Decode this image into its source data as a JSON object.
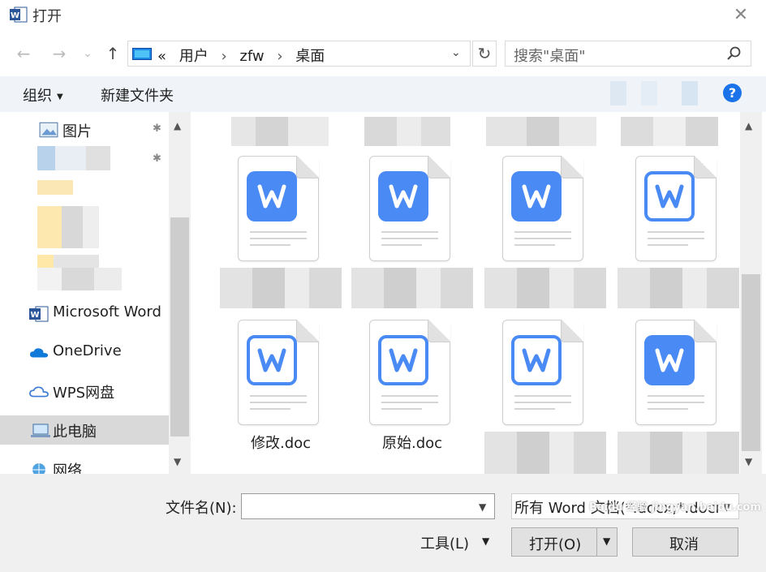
{
  "window": {
    "title": "打开",
    "close_glyph": "✕"
  },
  "nav": {
    "back_glyph": "←",
    "forward_glyph": "→",
    "recent_glyph": "⌄",
    "up_glyph": "↑",
    "breadcrumb_overflow": "«",
    "breadcrumbs": [
      "用户",
      "zfw",
      "桌面"
    ],
    "crumb_separator": "›",
    "refresh_glyph": "↻",
    "search_placeholder": "搜索\"桌面\""
  },
  "toolbar": {
    "organize_label": "组织",
    "new_folder_label": "新建文件夹",
    "help_glyph": "?"
  },
  "sidebar": {
    "pictures_label": "图片",
    "pin_glyph": "📌",
    "items": [
      {
        "label": "Microsoft Word",
        "icon": "word-icon"
      },
      {
        "label": "OneDrive",
        "icon": "onedrive-icon"
      },
      {
        "label": "WPS网盘",
        "icon": "wps-cloud-icon"
      },
      {
        "label": "此电脑",
        "icon": "computer-icon",
        "selected": true
      },
      {
        "label": "网络",
        "icon": "network-icon"
      }
    ]
  },
  "files": [
    {
      "name": "",
      "icon_style": "solid"
    },
    {
      "name": "",
      "icon_style": "solid"
    },
    {
      "name": "",
      "icon_style": "solid"
    },
    {
      "name": "",
      "icon_style": "outline"
    },
    {
      "name": "修改.doc",
      "icon_style": "outline"
    },
    {
      "name": "原始.doc",
      "icon_style": "outline"
    },
    {
      "name": "",
      "icon_style": "outline"
    },
    {
      "name": "",
      "icon_style": "solid"
    }
  ],
  "footer": {
    "filename_label": "文件名(N):",
    "filename_value": "",
    "filter_value": "所有 Word 文档(*.docx;*.docm",
    "tools_label": "工具(L)",
    "open_label": "打开(O)",
    "cancel_label": "取消",
    "watermark": "Baidu 经验 jingyan.baidu.com"
  },
  "colors": {
    "accent": "#4a8af4",
    "toolbar_bg": "#f0f4f9",
    "selected_bg": "#d9d9d9"
  }
}
